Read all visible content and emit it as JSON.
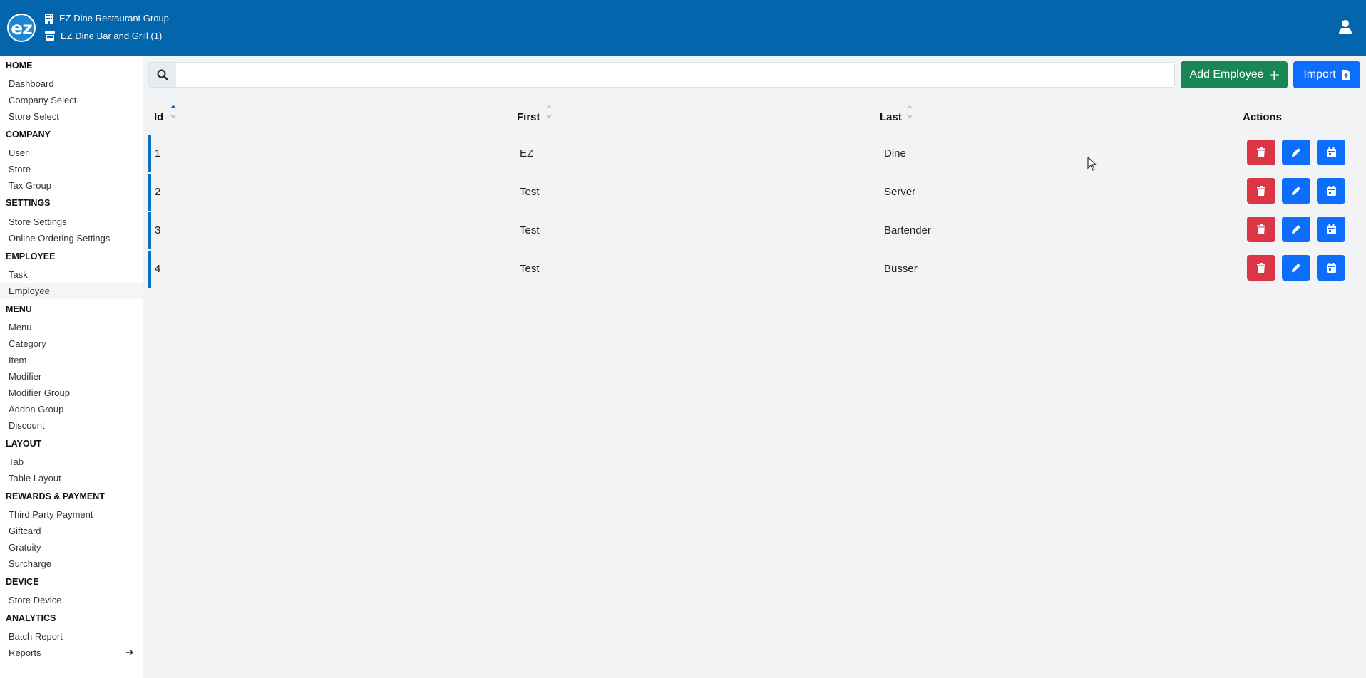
{
  "header": {
    "company": "EZ Dine Restaurant Group",
    "store": "EZ Dine Bar and Grill (1)",
    "logo_text": "ez"
  },
  "sidebar": {
    "sections": [
      {
        "title": "HOME",
        "items": [
          "Dashboard",
          "Company Select",
          "Store Select"
        ]
      },
      {
        "title": "COMPANY",
        "items": [
          "User",
          "Store",
          "Tax Group"
        ]
      },
      {
        "title": "SETTINGS",
        "items": [
          "Store Settings",
          "Online Ordering Settings"
        ]
      },
      {
        "title": "EMPLOYEE",
        "items": [
          "Task",
          "Employee"
        ]
      },
      {
        "title": "MENU",
        "items": [
          "Menu",
          "Category",
          "Item",
          "Modifier",
          "Modifier Group",
          "Addon Group",
          "Discount"
        ]
      },
      {
        "title": "LAYOUT",
        "items": [
          "Tab",
          "Table Layout"
        ]
      },
      {
        "title": "REWARDS & PAYMENT",
        "items": [
          "Third Party Payment",
          "Giftcard",
          "Gratuity",
          "Surcharge"
        ]
      },
      {
        "title": "DEVICE",
        "items": [
          "Store Device"
        ]
      },
      {
        "title": "ANALYTICS",
        "items": [
          "Batch Report",
          "Reports"
        ]
      }
    ],
    "active_item": "Employee"
  },
  "toolbar": {
    "search_value": "",
    "add_label": "Add Employee",
    "import_label": "Import"
  },
  "table": {
    "columns": [
      "Id",
      "First",
      "Last",
      "Actions"
    ],
    "rows": [
      {
        "id": "1",
        "first": "EZ",
        "last": "Dine"
      },
      {
        "id": "2",
        "first": "Test",
        "last": "Server"
      },
      {
        "id": "3",
        "first": "Test",
        "last": "Bartender"
      },
      {
        "id": "4",
        "first": "Test",
        "last": "Busser"
      }
    ]
  },
  "colors": {
    "header": "#0366ad",
    "add_button": "#198754",
    "primary": "#0d6efd",
    "danger": "#dc3545"
  }
}
